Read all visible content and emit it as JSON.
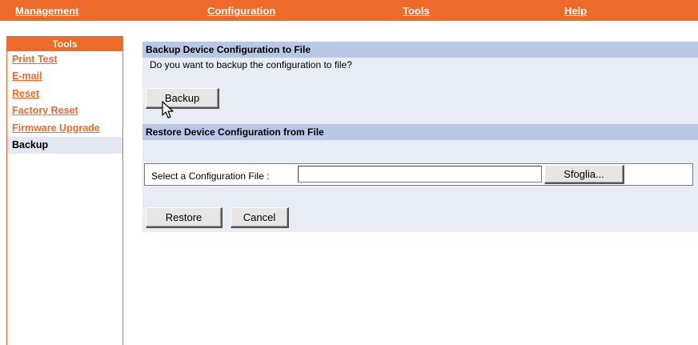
{
  "topnav": {
    "management": "Management",
    "configuration": "Configuration",
    "tools": "Tools",
    "help": "Help"
  },
  "sidebar": {
    "header": "Tools",
    "items": [
      {
        "label": "Print Test"
      },
      {
        "label": "E-mail"
      },
      {
        "label": "Reset"
      },
      {
        "label": "Factory Reset"
      },
      {
        "label": "Firmware Upgrade"
      },
      {
        "label": "Backup"
      }
    ]
  },
  "backup_section": {
    "title": "Backup Device Configuration to File",
    "question": "Do you want to backup the configuration to file?",
    "backup_button": "Backup"
  },
  "restore_section": {
    "title": "Restore Device Configuration from File",
    "file_label": "Select a Configuration File :",
    "file_value": "",
    "browse_button": "Sfoglia...",
    "restore_button": "Restore",
    "cancel_button": "Cancel"
  },
  "colors": {
    "accent": "#ee6a28",
    "section_header": "#b8c8e4",
    "panel": "#e8ecf4"
  },
  "icons": [
    "mouse-pointer-icon"
  ]
}
